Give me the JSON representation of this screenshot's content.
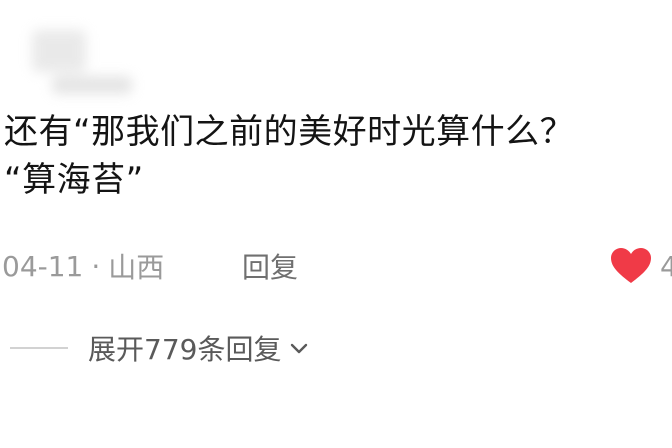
{
  "comment": {
    "text": "还有“那我们之前的美好时光算什么？\n“算海苔”",
    "date": "04-11",
    "separator": "·",
    "location": "山西",
    "reply_label": "回复",
    "like_count": "4"
  },
  "replies": {
    "expand_label": "展开779条回复"
  },
  "colors": {
    "heart": "#f03a47",
    "meta_text": "#9a9a9a",
    "body_text": "#141414"
  }
}
